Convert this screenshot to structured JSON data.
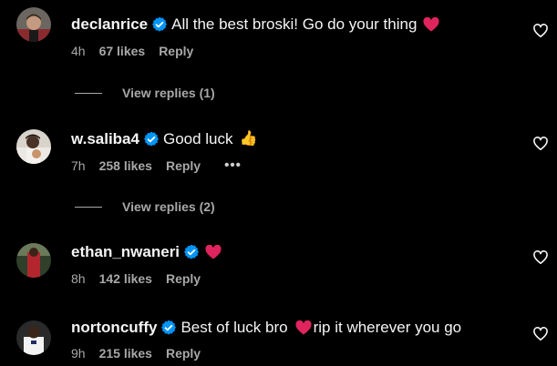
{
  "comments": [
    {
      "username": "declanrice",
      "text": "All the best broski! Go do your thing",
      "text_after_heart": "",
      "trailing_emoji": "heart",
      "time": "4h",
      "likes": "67 likes",
      "reply": "Reply",
      "view_replies": "View replies (1)"
    },
    {
      "username": "w.saliba4",
      "text": "Good luck",
      "trailing_emoji": "thumbs-up",
      "thumb": "👍",
      "time": "7h",
      "likes": "258 likes",
      "reply": "Reply",
      "more": "•••",
      "view_replies": "View replies (2)"
    },
    {
      "username": "ethan_nwaneri",
      "text": "",
      "trailing_emoji": "heart",
      "time": "8h",
      "likes": "142 likes",
      "reply": "Reply"
    },
    {
      "username": "nortoncuffy",
      "text": "Best of luck bro",
      "text_after_heart": "rip it wherever you go",
      "trailing_emoji": "heart",
      "time": "9h",
      "likes": "215 likes",
      "reply": "Reply"
    }
  ],
  "colors": {
    "background": "#000000",
    "verified": "#0095f6",
    "heart": "#e0245e",
    "secondary_text": "#a8a8a8"
  }
}
